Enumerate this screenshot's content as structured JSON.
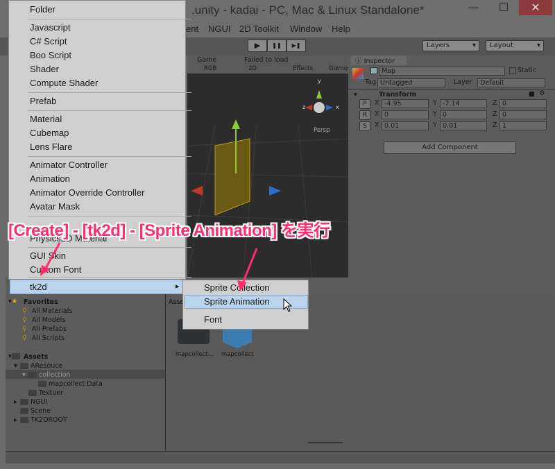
{
  "window": {
    "title": ".unity - kadai - PC, Mac & Linux Standalone*",
    "minimize": "—",
    "maximize": "☐",
    "close": "✕",
    "close_color": "#c0392b"
  },
  "menubar": [
    "ent",
    "NGUI",
    "2D Toolkit",
    "Window",
    "Help"
  ],
  "toolbar": {
    "play": "▶",
    "pause": "❚❚",
    "step": "▶❚",
    "layers": "Layers",
    "layout": "Layout"
  },
  "scene": {
    "tab_game": "Game",
    "failed": "Failed to load",
    "rgb": "RGB",
    "mode2d": "2D",
    "effects": "Effects",
    "gizmos": "Gizmos",
    "persp": "Persp",
    "axis_y": "y",
    "axis_x": "x",
    "axis_z": "z"
  },
  "inspector": {
    "tab": "Inspector",
    "name": "Map",
    "static": "Static",
    "tag_label": "Tag",
    "tag": "Untagged",
    "layer_label": "Layer",
    "layer": "Default",
    "transform": "Transform",
    "rows": [
      {
        "btn": "P",
        "x": "-4.95",
        "y": "-7.14",
        "z": "0"
      },
      {
        "btn": "R",
        "x": "0",
        "y": "0",
        "z": "0"
      },
      {
        "btn": "S",
        "x": "0.01",
        "y": "0.01",
        "z": "1"
      }
    ],
    "add_component": "Add Component"
  },
  "menu": {
    "items": [
      "Folder",
      "Javascript",
      "C# Script",
      "Boo Script",
      "Shader",
      "Compute Shader",
      "Prefab",
      "Material",
      "Cubemap",
      "Lens Flare",
      "Animator Controller",
      "Animation",
      "Animator Override Controller",
      "Avatar Mask",
      "Physics2D Material",
      "GUI Skin",
      "Custom Font"
    ],
    "highlighted": "tk2d",
    "arrow": "▸"
  },
  "submenu": {
    "items": [
      "Sprite Collection",
      "Sprite Animation",
      "Font"
    ],
    "selected": "Sprite Animation"
  },
  "banner": "[Create] - [tk2d] - [Sprite Animation] を実行",
  "banner_color": "#ff2d6b",
  "project": {
    "favorites": "Favorites",
    "fav_items": [
      "All Materials",
      "All Models",
      "All Prefabs",
      "All Scripts"
    ],
    "assets": "Assets",
    "tree": [
      "AResouce",
      "collection",
      "mapcollect Data",
      "Textuer",
      "NGUI",
      "Scene",
      "TK2DROOT"
    ],
    "breadcrumb": "Assets",
    "files": [
      "mapcollect...",
      "mapcollect"
    ]
  }
}
